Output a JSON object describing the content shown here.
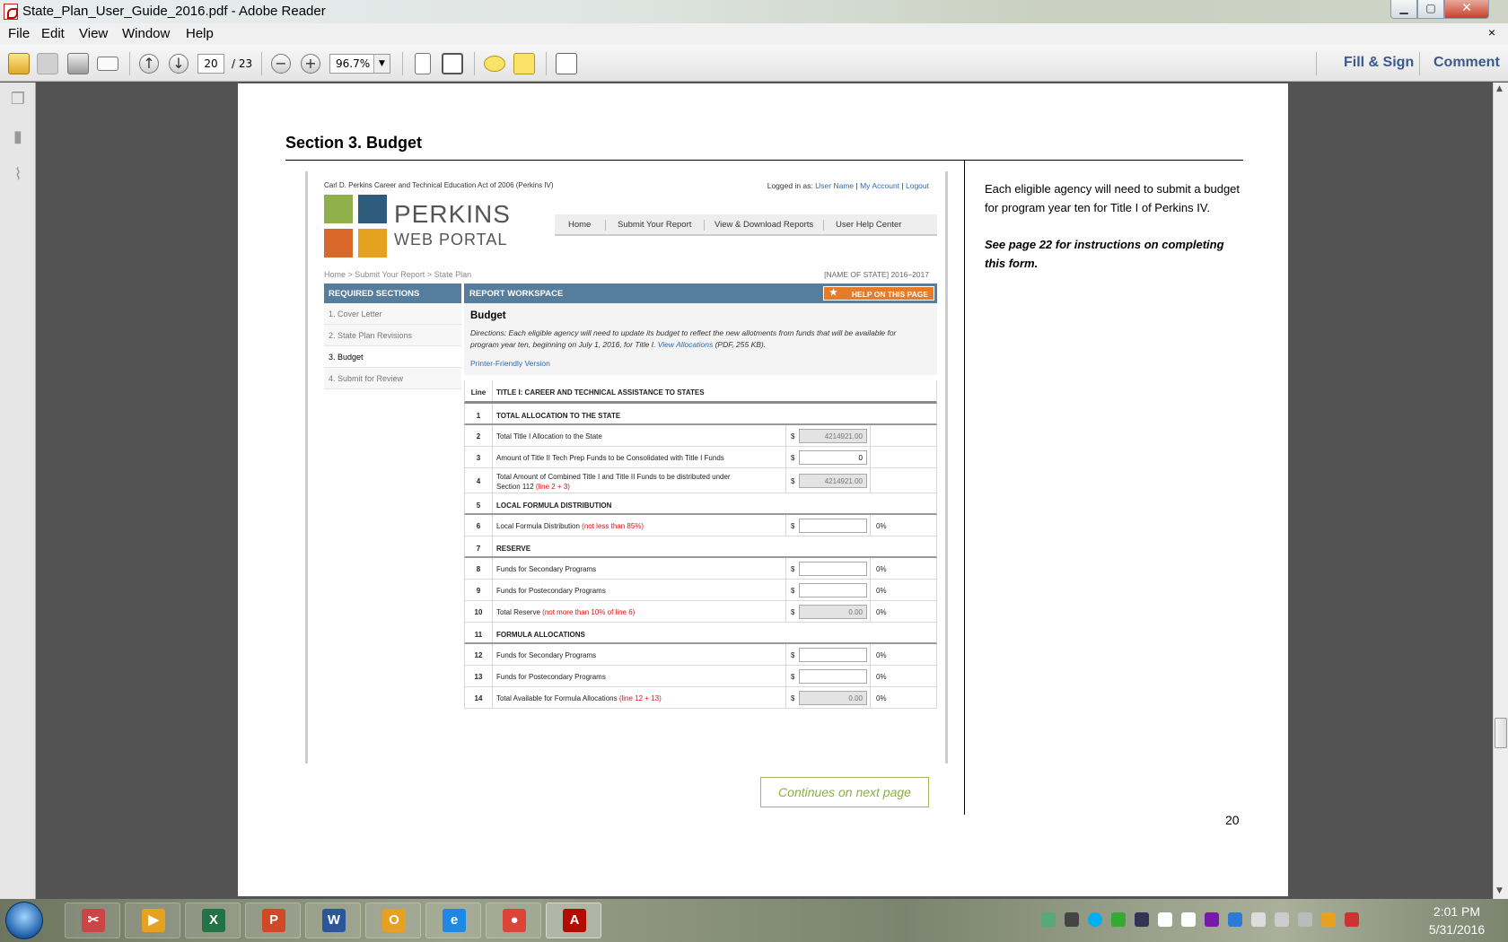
{
  "window": {
    "title": "State_Plan_User_Guide_2016.pdf - Adobe Reader",
    "minimize": "▁",
    "maximize": "▢",
    "close": "✕"
  },
  "menu": {
    "items": [
      "File",
      "Edit",
      "View",
      "Window",
      "Help"
    ],
    "close_doc": "×"
  },
  "toolbar": {
    "page_current": "20",
    "page_total": "/ 23",
    "zoom": "96.7%",
    "fill_sign": "Fill & Sign",
    "comment": "Comment",
    "icons": [
      "open-icon",
      "save-icon",
      "print-icon",
      "email-icon",
      "prev-page-icon",
      "next-page-icon",
      "zoom-out-icon",
      "zoom-in-icon",
      "scroll-mode-icon",
      "fit-page-icon",
      "comment-bubble-icon",
      "highlight-icon",
      "full-screen-icon"
    ]
  },
  "left_pane": {
    "icons": [
      "pages-icon",
      "bookmarks-icon",
      "attachments-icon"
    ]
  },
  "document": {
    "section_title": "Section 3. Budget",
    "side_text": "Each eligible agency will need to submit a budget for program year ten for Title I of Perkins IV.",
    "side_note": "See page 22 for instructions on completing this form.",
    "continues": "Continues on next page",
    "page_number": "20"
  },
  "portal": {
    "act_title": "Carl D. Perkins Career and Technical Education Act of 2006 (Perkins IV)",
    "logged_in_label": "Logged in as:",
    "user_name": "User Name",
    "my_account": "My Account",
    "logout": "Logout",
    "separator": "|",
    "logo_line1": "PERKINS",
    "logo_line2": "WEB PORTAL",
    "nav": [
      "Home",
      "Submit Your Report",
      "View & Download Reports",
      "User Help Center"
    ],
    "breadcrumb": "Home  >  Submit Your Report  >  State Plan",
    "state_label": "[NAME OF STATE] 2016–2017",
    "required_sections_title": "REQUIRED SECTIONS",
    "required_sections": [
      "1. Cover Letter",
      "2. State Plan Revisions",
      "3. Budget",
      "4. Submit for Review"
    ],
    "workspace_title": "REPORT WORKSPACE",
    "help_button": "HELP ON THIS PAGE",
    "budget_title": "Budget",
    "directions": "Directions: Each eligible agency will need to update its budget to reflect the new allotments from funds that will be available for program year ten, beginning on July 1, 2016, for Title I.",
    "view_allocations": "View Allocations",
    "pdf_size": "(PDF, 255 KB).",
    "printer_friendly": "Printer-Friendly Version",
    "table_header_line": "Line",
    "table_header_title": "TITLE I: CAREER AND TECHNICAL ASSISTANCE TO STATES",
    "currency": "$",
    "rows": [
      {
        "line": "1",
        "type": "section",
        "label": "TOTAL ALLOCATION TO THE STATE"
      },
      {
        "line": "2",
        "type": "item",
        "label": "Total Title I Allocation to the State",
        "note": "",
        "value": "4214921.00",
        "readonly": true,
        "pct": ""
      },
      {
        "line": "3",
        "type": "item",
        "label": "Amount of Title II Tech Prep Funds to be Consolidated with Title I Funds",
        "note": "",
        "value": "0",
        "readonly": false,
        "pct": ""
      },
      {
        "line": "4",
        "type": "tall",
        "label": "Total Amount of Combined Title I and Title II Funds to be distributed under",
        "label2": "Section 112",
        "note": "(line 2 + 3)",
        "value": "4214921.00",
        "readonly": true,
        "pct": ""
      },
      {
        "line": "5",
        "type": "section",
        "label": "LOCAL FORMULA DISTRIBUTION"
      },
      {
        "line": "6",
        "type": "item",
        "label": "Local Formula Distribution",
        "note": "(not less than 85%)",
        "value": "",
        "readonly": false,
        "pct": "0%"
      },
      {
        "line": "7",
        "type": "section",
        "label": "RESERVE"
      },
      {
        "line": "8",
        "type": "item",
        "label": "Funds for Secondary Programs",
        "note": "",
        "value": "",
        "readonly": false,
        "pct": "0%"
      },
      {
        "line": "9",
        "type": "item",
        "label": "Funds for Postecondary Programs",
        "note": "",
        "value": "",
        "readonly": false,
        "pct": "0%"
      },
      {
        "line": "10",
        "type": "item",
        "label": "Total Reserve",
        "note": "(not more than 10% of line 6)",
        "value": "0.00",
        "readonly": true,
        "pct": "0%"
      },
      {
        "line": "11",
        "type": "section",
        "label": "FORMULA ALLOCATIONS"
      },
      {
        "line": "12",
        "type": "item",
        "label": "Funds for Secondary Programs",
        "note": "",
        "value": "",
        "readonly": false,
        "pct": "0%"
      },
      {
        "line": "13",
        "type": "item",
        "label": "Funds for Postecondary Programs",
        "note": "",
        "value": "",
        "readonly": false,
        "pct": "0%"
      },
      {
        "line": "14",
        "type": "item",
        "label": "Total Available for Formula Allocations",
        "note": "(line 12 + 13)",
        "value": "0.00",
        "readonly": true,
        "pct": "0%"
      }
    ]
  },
  "taskbar": {
    "apps": [
      {
        "name": "snipping-tool-icon",
        "glyph": "✂",
        "color": "#c44"
      },
      {
        "name": "media-player-icon",
        "glyph": "▶",
        "color": "#e8a020"
      },
      {
        "name": "excel-icon",
        "glyph": "X",
        "color": "#217346"
      },
      {
        "name": "powerpoint-icon",
        "glyph": "P",
        "color": "#d24726"
      },
      {
        "name": "word-icon",
        "glyph": "W",
        "color": "#2b579a"
      },
      {
        "name": "outlook-icon",
        "glyph": "O",
        "color": "#e8a020"
      },
      {
        "name": "internet-explorer-icon",
        "glyph": "e",
        "color": "#1e88e5"
      },
      {
        "name": "chrome-icon",
        "glyph": "●",
        "color": "#db4437"
      },
      {
        "name": "adobe-reader-icon",
        "glyph": "A",
        "color": "#b30b00"
      }
    ],
    "time": "2:01 PM",
    "date": "5/31/2016"
  }
}
